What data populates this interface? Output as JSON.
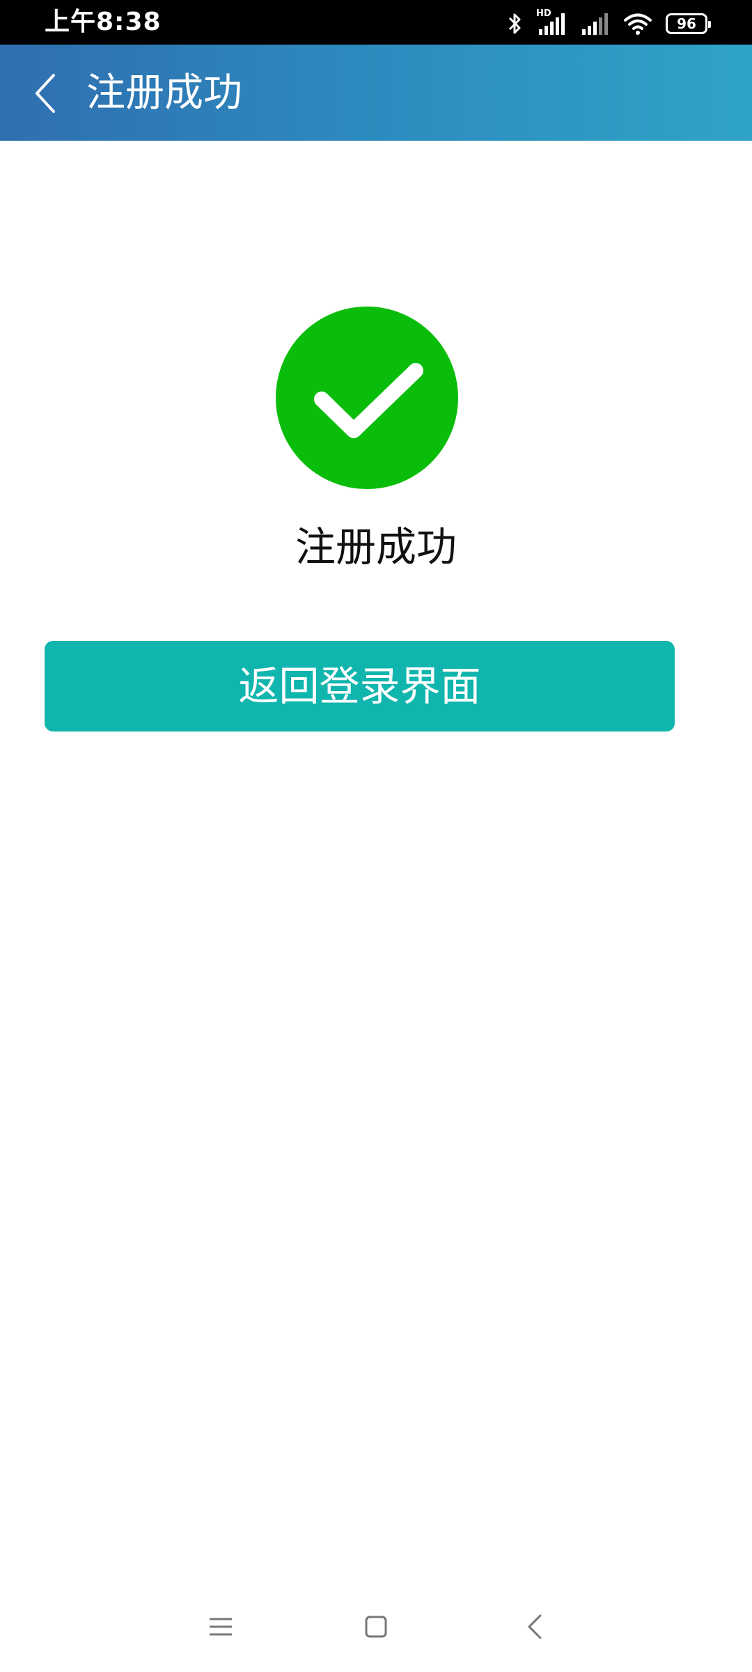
{
  "status_bar": {
    "time": "上午8:38",
    "network_badge": "HD",
    "battery_level": "96",
    "icons": [
      "bluetooth-icon",
      "signal-hd-icon",
      "signal-icon",
      "wifi-icon",
      "battery-icon"
    ]
  },
  "app_bar": {
    "title": "注册成功",
    "back_icon": "chevron-left-icon",
    "gradient": [
      "#2f6fb0",
      "#2fa3c8"
    ]
  },
  "main": {
    "success_icon": "check-circle-icon",
    "success_color": "#0bbd0b",
    "message": "注册成功",
    "return_button_label": "返回登录界面",
    "button_color": "#10b5ae"
  },
  "nav_bar": {
    "items": [
      "menu-icon",
      "home-icon",
      "back-icon"
    ]
  }
}
